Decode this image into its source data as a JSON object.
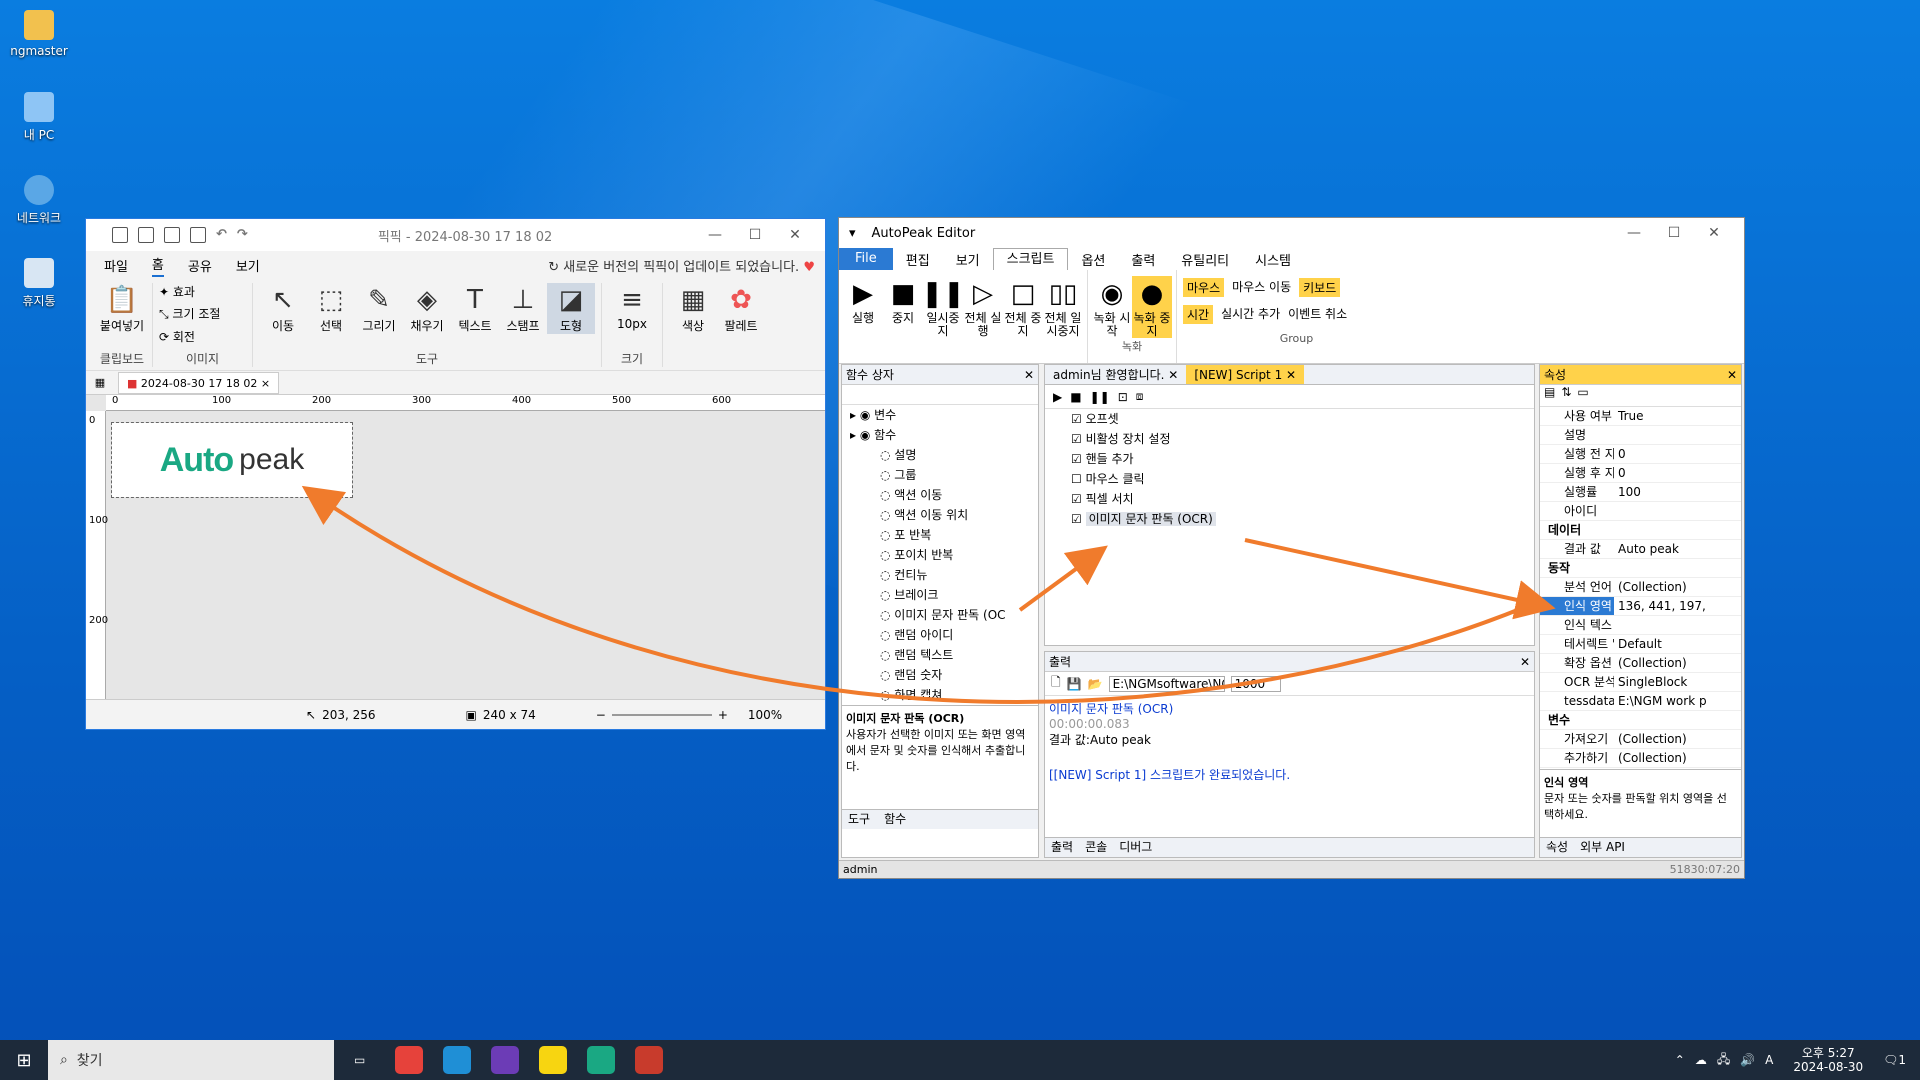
{
  "desktop": {
    "icons": [
      {
        "label": "ngmaster"
      },
      {
        "label": "내 PC"
      },
      {
        "label": "네트워크"
      },
      {
        "label": "휴지통"
      }
    ]
  },
  "paint": {
    "title": "픽픽 - 2024-08-30 17 18 02",
    "tabs": [
      "파일",
      "홈",
      "공유",
      "보기"
    ],
    "update_notice": "새로운 버전의 픽픽이 업데이트 되었습니다.",
    "clipboard": {
      "paste": "붙여넣기",
      "group": "클립보드"
    },
    "image_group": {
      "effects": "효과",
      "resize": "크기 조절",
      "rotate": "회전",
      "group": "이미지"
    },
    "tools": [
      {
        "label": "이동",
        "glyph": "↖"
      },
      {
        "label": "선택",
        "glyph": "⬚"
      },
      {
        "label": "그리기",
        "glyph": "✎"
      },
      {
        "label": "채우기",
        "glyph": "◈"
      },
      {
        "label": "텍스트",
        "glyph": "T"
      },
      {
        "label": "스탬프",
        "glyph": "⊥"
      },
      {
        "label": "도형",
        "glyph": "◪"
      }
    ],
    "tools_group": "도구",
    "size": {
      "value": "10px",
      "group": "크기"
    },
    "color": "색상",
    "palette": "팔레트",
    "doc_tab": "2024-08-30 17 18 02",
    "ruler_h": [
      "0",
      "100",
      "200",
      "300",
      "400",
      "500",
      "600"
    ],
    "ruler_v": [
      "0",
      "100",
      "200"
    ],
    "canvas_logo": {
      "auto": "Auto",
      "peak": "peak"
    },
    "status": {
      "cursor": "203, 256",
      "size": "240 x 74",
      "zoom": "100%"
    }
  },
  "autopeak": {
    "title": "AutoPeak Editor",
    "menu": [
      "File",
      "편집",
      "보기",
      "스크립트",
      "옵션",
      "출력",
      "유틸리티",
      "시스템"
    ],
    "ribbon": {
      "buttons": [
        {
          "label": "실행",
          "glyph": "▶"
        },
        {
          "label": "중지",
          "glyph": "■"
        },
        {
          "label": "일시중지",
          "glyph": "❚❚"
        },
        {
          "label": "전체 실행",
          "glyph": "▷"
        },
        {
          "label": "전체 중지",
          "glyph": "□"
        },
        {
          "label": "전체 일시중지",
          "glyph": "▯▯"
        }
      ],
      "rec": [
        {
          "label": "녹화 시작",
          "glyph": "◉"
        },
        {
          "label": "녹화 중지",
          "glyph": "●"
        }
      ],
      "rec_group": "녹화",
      "opts": [
        "마우스",
        "마우스 이동",
        "키보드",
        "시간",
        "실시간 추가",
        "이벤트 취소"
      ],
      "group": "Group"
    },
    "func_box": {
      "title": "함수 상자",
      "items": [
        "변수",
        "함수",
        "설명",
        "그룹",
        "액션 이동",
        "액션 이동 위치",
        "포 반복",
        "포이치 반복",
        "컨티뉴",
        "브레이크",
        "이미지 문자 판독 (OC",
        "랜덤 아이디",
        "랜덤 텍스트",
        "랜덤 숫자",
        "화면 캡쳐"
      ],
      "desc_title": "이미지 문자 판독 (OCR)",
      "desc": "사용자가 선택한 이미지 또는 화면 영역에서 문자 및 숫자를 인식해서 추출합니다.",
      "bottom_tabs": [
        "도구",
        "함수"
      ]
    },
    "doc_tabs": [
      "admin님 환영합니다.",
      "[NEW] Script 1"
    ],
    "script": [
      "오프셋",
      "비활성 장치 설정",
      "핸들 추가",
      "마우스 클릭",
      "픽셀 서치",
      "이미지 문자 판독 (OCR)"
    ],
    "output": {
      "title": "출력",
      "path": "E:\\NGMsoftware\\NG",
      "count": "1000",
      "lines": [
        "이미지 문자 판독 (OCR)",
        "00:00:00.083",
        "결과 값:Auto peak",
        "[[NEW] Script 1] 스크립트가 완료되었습니다."
      ],
      "bottom_tabs": [
        "출력",
        "콘솔",
        "디버그"
      ]
    },
    "props": {
      "title": "속성",
      "rows": [
        {
          "k": "사용 여부",
          "v": "True"
        },
        {
          "k": "설명",
          "v": ""
        },
        {
          "k": "실행 전 지",
          "v": "0"
        },
        {
          "k": "실행 후 지",
          "v": "0"
        },
        {
          "k": "실행률",
          "v": "100"
        },
        {
          "k": "아이디",
          "v": ""
        }
      ],
      "cat_data": "데이터",
      "data_rows": [
        {
          "k": "결과 값",
          "v": "Auto peak"
        }
      ],
      "cat_action": "동작",
      "action_rows": [
        {
          "k": "분석 언어",
          "v": "(Collection)"
        },
        {
          "k": "인식 영역",
          "v": "136, 441, 197,"
        },
        {
          "k": "인식 텍스",
          "v": ""
        },
        {
          "k": "테서렉트 '",
          "v": "Default"
        },
        {
          "k": "확장 옵션",
          "v": "(Collection)"
        },
        {
          "k": "OCR 분석",
          "v": "SingleBlock"
        },
        {
          "k": "tessdata 폴",
          "v": "E:\\NGM work p"
        }
      ],
      "cat_var": "변수",
      "var_rows": [
        {
          "k": "가져오기",
          "v": "(Collection)"
        },
        {
          "k": "추가하기",
          "v": "(Collection)"
        }
      ],
      "desc_title": "인식 영역",
      "desc": "문자 또는 숫자를 판독할 위치 영역을 선택하세요.",
      "bottom_tabs": [
        "속성",
        "외부 API"
      ]
    },
    "status": {
      "user": "admin",
      "time": "51830:07:20"
    }
  },
  "taskbar": {
    "search": "찾기",
    "time": "오후 5:27",
    "date": "2024-08-30",
    "ime": "A",
    "notif": "1"
  }
}
